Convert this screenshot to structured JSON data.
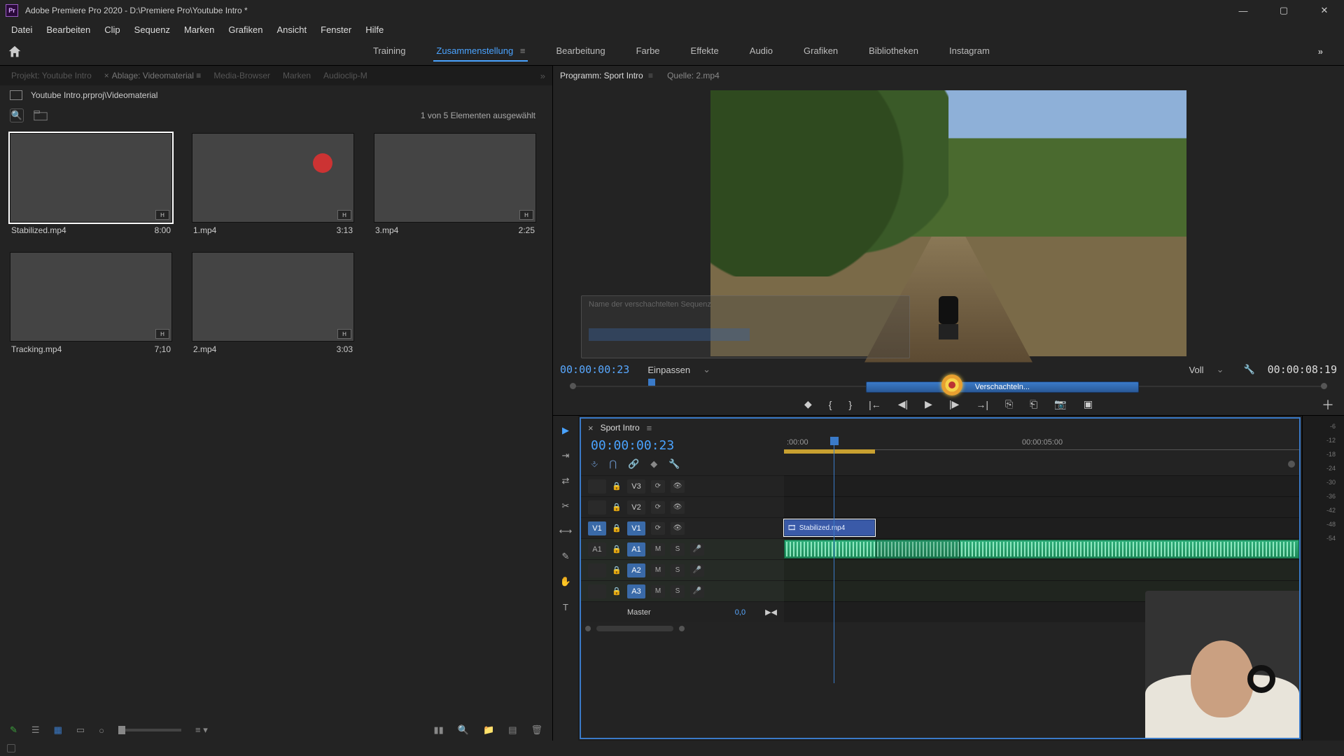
{
  "title_bar": {
    "app_icon_text": "Pr",
    "title": "Adobe Premiere Pro 2020 - D:\\Premiere Pro\\Youtube Intro *"
  },
  "menu": [
    "Datei",
    "Bearbeiten",
    "Clip",
    "Sequenz",
    "Marken",
    "Grafiken",
    "Ansicht",
    "Fenster",
    "Hilfe"
  ],
  "workspace": {
    "tabs": [
      "Training",
      "Zusammenstellung",
      "Bearbeitung",
      "Farbe",
      "Effekte",
      "Audio",
      "Grafiken",
      "Bibliotheken",
      "Instagram"
    ],
    "active_index": 1
  },
  "project": {
    "tabs": [
      {
        "label": "Projekt: Youtube Intro"
      },
      {
        "label": "Ablage: Videomaterial"
      },
      {
        "label": "Media-Browser"
      },
      {
        "label": "Marken"
      },
      {
        "label": "Audioclip-M"
      }
    ],
    "bin_path": "Youtube Intro.prproj\\Videomaterial",
    "selection_text": "1 von 5 Elementen ausgewählt",
    "items": [
      {
        "name": "Stabilized.mp4",
        "dur": "8:00",
        "selected": true
      },
      {
        "name": "1.mp4",
        "dur": "3:13"
      },
      {
        "name": "3.mp4",
        "dur": "2:25"
      },
      {
        "name": "Tracking.mp4",
        "dur": "7;10"
      },
      {
        "name": "2.mp4",
        "dur": "3:03"
      }
    ]
  },
  "program": {
    "tabs": [
      {
        "label": "Programm: Sport Intro",
        "active": true
      },
      {
        "label": "Quelle: 2.mp4"
      }
    ],
    "timecode": "00:00:00:23",
    "fit_label": "Einpassen",
    "quality": "Voll",
    "duration": "00:00:08:19",
    "progress_label": "Verschachteln...",
    "dialog_hint": "Name der verschachtelten Sequenz"
  },
  "timeline": {
    "sequence_name": "Sport Intro",
    "timecode": "00:00:00:23",
    "ruler": {
      "t0": ":00:00",
      "t5": "00:00:05:00"
    },
    "video_tracks": [
      {
        "src": "",
        "tgt": "V3"
      },
      {
        "src": "",
        "tgt": "V2"
      },
      {
        "src": "V1",
        "src_on": true,
        "tgt": "V1",
        "tgt_on": true
      }
    ],
    "audio_tracks": [
      {
        "src": "A1",
        "tgt": "A1",
        "tgt_on": true
      },
      {
        "src": "",
        "tgt": "A2",
        "tgt_on": true
      },
      {
        "src": "",
        "tgt": "A3",
        "tgt_on": true
      }
    ],
    "master": {
      "label": "Master",
      "value": "0,0"
    },
    "clip_v1": "Stabilized.mp4"
  },
  "meters": {
    "ticks": [
      "-6",
      "-12",
      "-18",
      "-24",
      "-30",
      "-36",
      "-42",
      "-48",
      "-54"
    ]
  }
}
